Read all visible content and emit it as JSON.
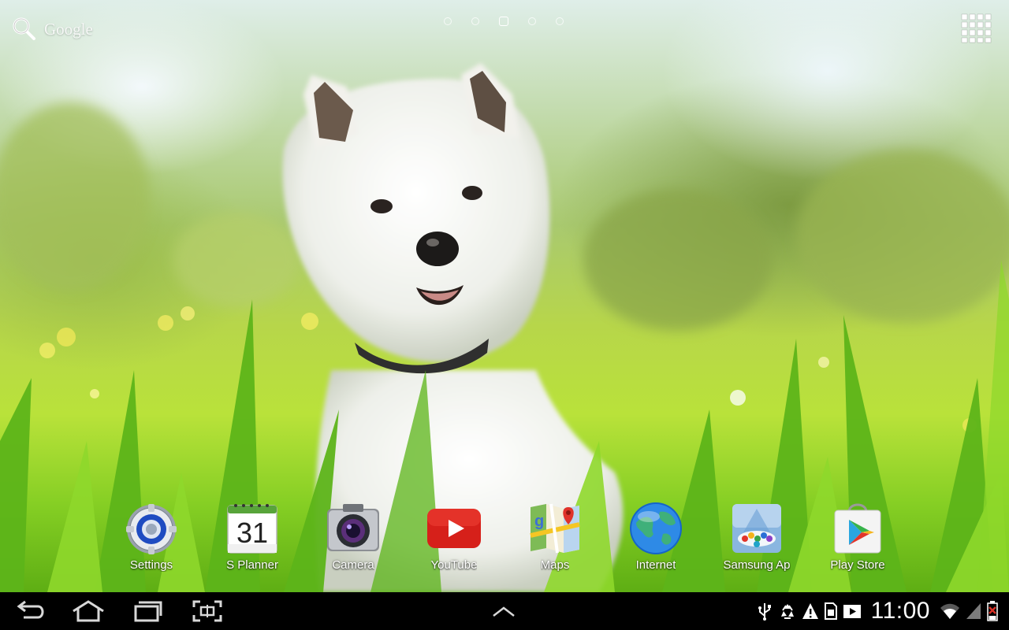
{
  "home_screen": {
    "search_label": "Google",
    "page_indicator": {
      "pages": 5,
      "current": 3
    }
  },
  "dock": {
    "items": [
      {
        "label": "Settings",
        "icon": "settings-gear-icon"
      },
      {
        "label": "S Planner",
        "icon": "calendar-icon",
        "date": "31"
      },
      {
        "label": "Camera",
        "icon": "camera-icon"
      },
      {
        "label": "YouTube",
        "icon": "youtube-icon"
      },
      {
        "label": "Maps",
        "icon": "maps-icon"
      },
      {
        "label": "Internet",
        "icon": "globe-icon"
      },
      {
        "label": "Samsung Ap",
        "icon": "samsung-apps-icon"
      },
      {
        "label": "Play Store",
        "icon": "play-store-icon"
      }
    ]
  },
  "system_bar": {
    "nav": [
      "back-icon",
      "home-icon",
      "recent-apps-icon",
      "screenshot-icon"
    ],
    "clock": "11:00",
    "status_icons": [
      "usb-icon",
      "recycle-icon",
      "warning-icon",
      "sd-card-icon",
      "media-play-icon",
      "wifi-icon",
      "signal-icon",
      "battery-icon"
    ],
    "colors": {
      "battery_alert": "#d93025",
      "status_white": "#ffffff"
    }
  }
}
